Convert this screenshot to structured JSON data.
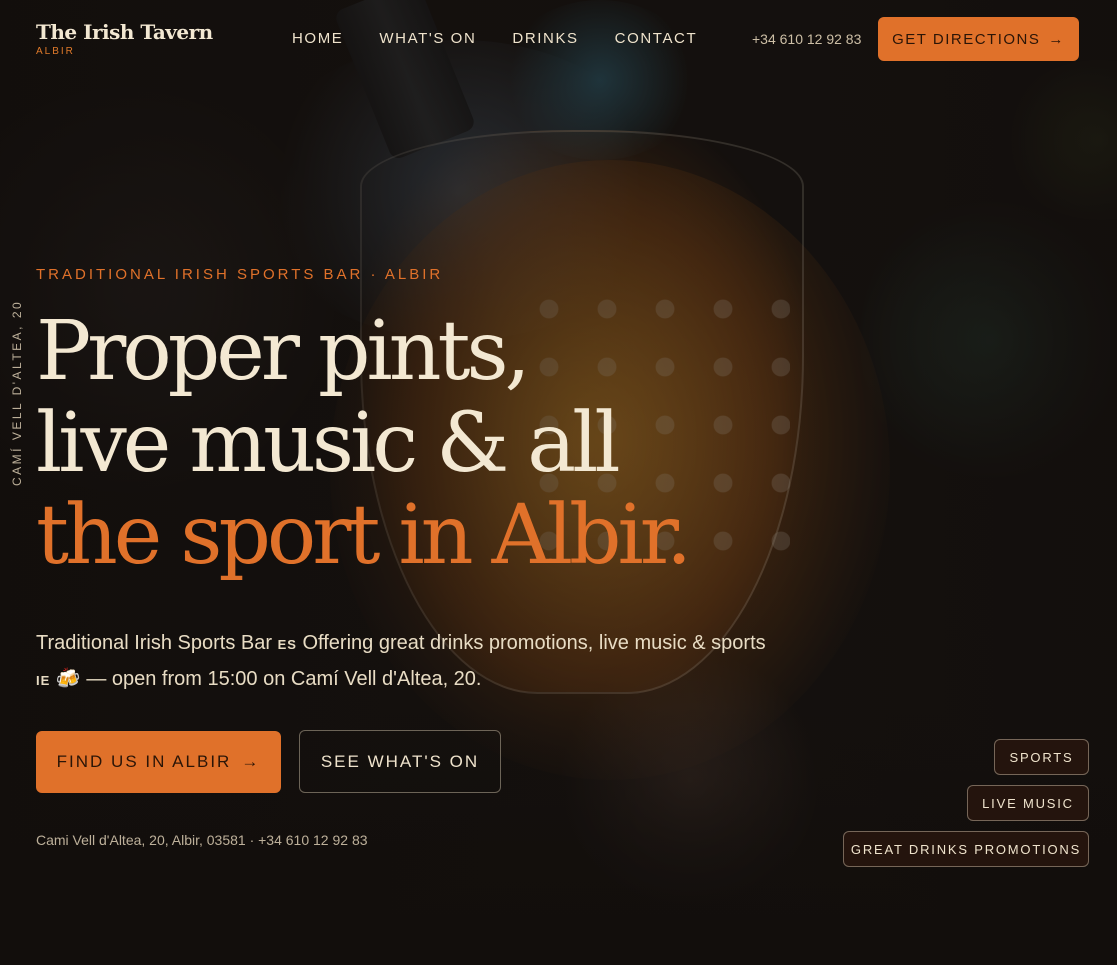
{
  "header": {
    "brand_name": "The Irish Tavern",
    "brand_sub": "ALBIR",
    "nav": [
      "HOME",
      "WHAT'S ON",
      "DRINKS",
      "CONTACT"
    ],
    "phone": "+34 610 12 92 83",
    "cta_label": "GET DIRECTIONS",
    "cta_icon": "→"
  },
  "hero": {
    "vertical_address": "CAMÍ VELL D'ALTEA, 20",
    "eyebrow": "TRADITIONAL IRISH SPORTS BAR · ALBIR",
    "headline_lines": [
      "Proper pints,",
      "live music & all",
      "the sport in Albir."
    ],
    "lead_part1": "Traditional Irish Sports Bar",
    "lead_tag1": "ES",
    "lead_part2": "Offering great drinks promotions, live music & sports",
    "lead_tag2": "IE",
    "lead_emoji": "🍻",
    "lead_part3": "— open from 15:00 on Camí Vell d'Altea, 20.",
    "primary_button": "FIND US IN ALBIR",
    "primary_icon": "→",
    "secondary_button": "SEE WHAT'S ON",
    "address_line": "Cami Vell d'Altea, 20, Albir, 03581 · +34 610 12 92 83"
  },
  "tags": [
    "SPORTS",
    "LIVE MUSIC",
    "GREAT DRINKS PROMOTIONS"
  ],
  "colors": {
    "accent": "#e0712a",
    "background": "#16120f",
    "text": "#f3e8d2"
  }
}
